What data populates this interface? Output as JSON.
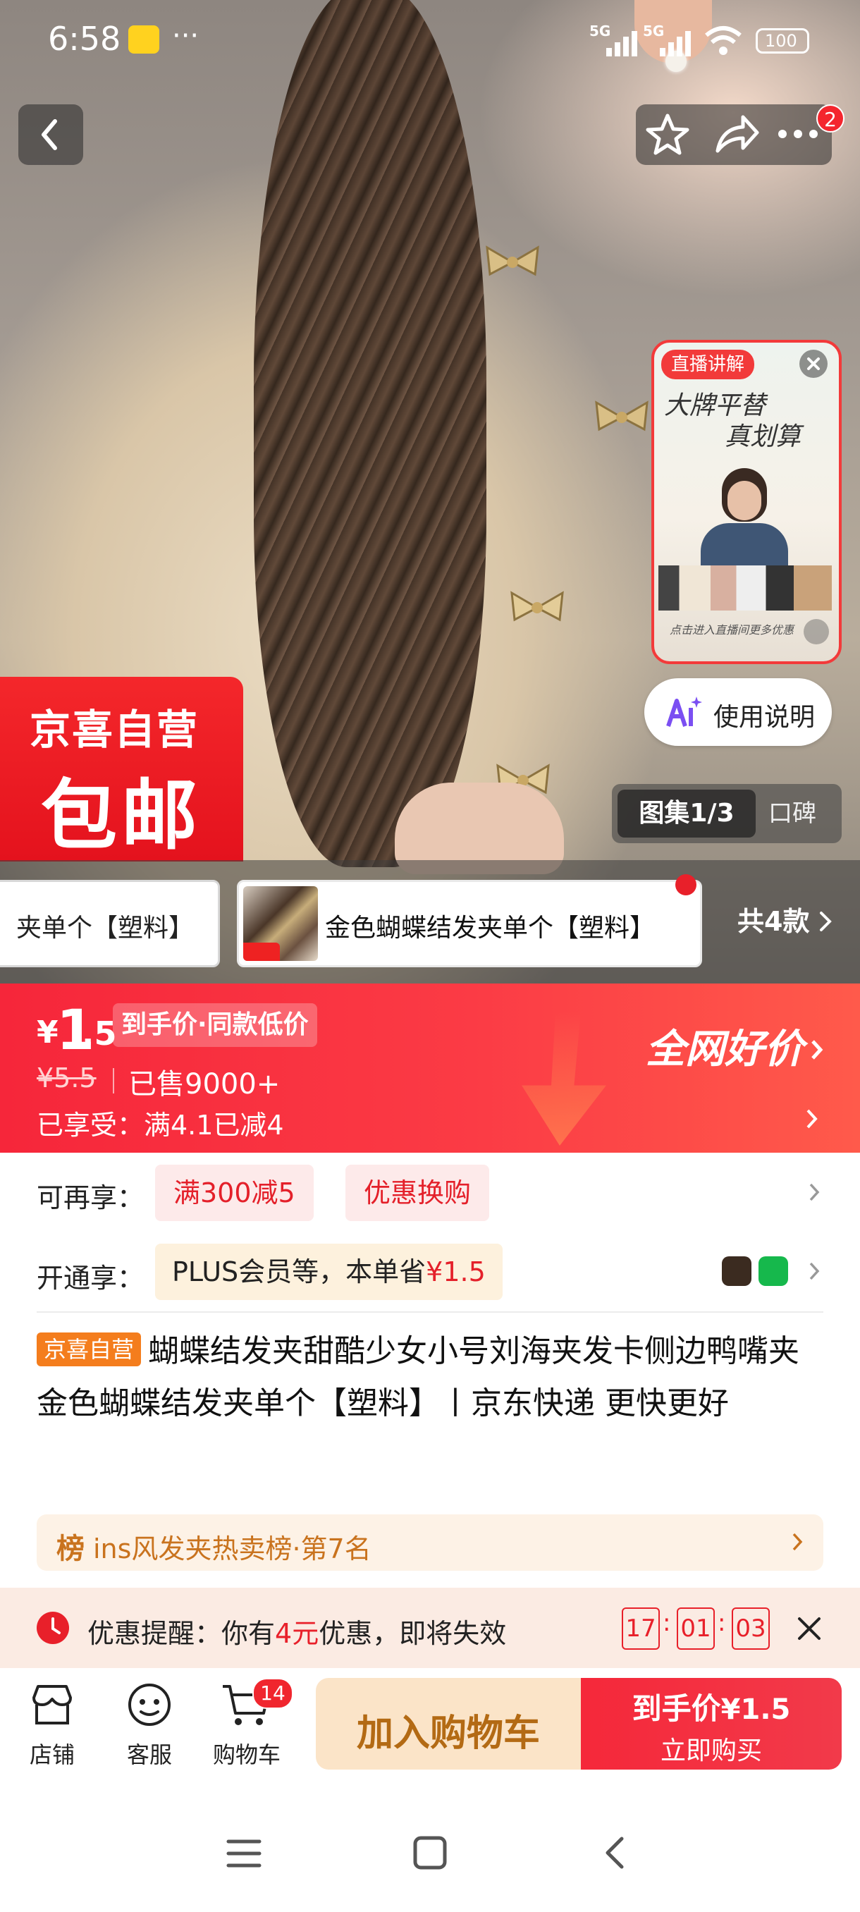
{
  "status_bar": {
    "time": "6:58",
    "dots": "···",
    "signal1": "5G",
    "signal2": "5G",
    "battery": "100"
  },
  "header": {
    "notification_badge": "2"
  },
  "promo_badge": {
    "line1": "京喜自营",
    "line2": "包邮"
  },
  "live_video": {
    "tag": "直播讲解",
    "headline1": "大牌平替",
    "headline2": "真划算",
    "caption": "点击进入直播间更多优惠"
  },
  "ai_button": {
    "label": "使用说明"
  },
  "gallery_tabs": {
    "gallery": "图集1/3",
    "reviews": "口碑"
  },
  "variants": {
    "prev_label": "夹单个【塑料】",
    "current_label": "金色蝴蝶结发夹单个【塑料】",
    "total": "共4款"
  },
  "price": {
    "currency": "¥",
    "main": "1",
    "decimal": ".5",
    "tag": "到手价·同款低价",
    "original": "¥5.5",
    "sold": "已售9000+",
    "enjoyed": "已享受：满4.1已减4",
    "slogan": "全网好价"
  },
  "promotions": {
    "more_label": "可再享：",
    "tag1": "满300减5",
    "tag2": "优惠换购",
    "plus_label": "开通享：",
    "plus_text": "PLUS会员等，本单省",
    "plus_amount": "¥1.5"
  },
  "product": {
    "badge": "京喜自营",
    "title": "蝴蝶结发夹甜酷少女小号刘海夹发卡侧边鸭嘴夹 金色蝴蝶结发夹单个【塑料】丨京东快递 更快更好"
  },
  "ranking": {
    "prefix": "榜",
    "text": "ins风发夹热卖榜·第7名"
  },
  "reminder": {
    "label": "优惠提醒：你有",
    "amount": "4元",
    "suffix": "优惠，即将失效",
    "hh": "17",
    "mm": "01",
    "ss": "03"
  },
  "bottom_bar": {
    "store": "店铺",
    "service": "客服",
    "cart": "购物车",
    "cart_badge": "14",
    "add_to_cart": "加入购物车",
    "buy_price_label": "到手价",
    "buy_price": "¥1.5",
    "buy_now": "立即购买"
  },
  "colors": {
    "brand_red": "#f6263a",
    "orange_cart": "#fbe4c8",
    "white": "#ffffff"
  }
}
